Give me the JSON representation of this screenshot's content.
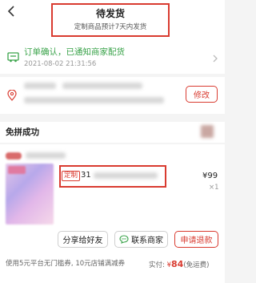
{
  "header": {
    "back_icon": "chevron-left-icon",
    "title": "待发货",
    "subtitle": "定制商品预计7天内发货"
  },
  "logistics": {
    "icon": "truck-icon",
    "status": "订单确认，已通知商家配货",
    "time": "2021-08-02 21:31:56",
    "arrow_icon": "chevron-right-icon",
    "status_color": "#3aa34a"
  },
  "address": {
    "icon": "location-pin-icon",
    "edit_label": "修改"
  },
  "group": {
    "label": "免拼成功"
  },
  "product": {
    "tag": "定制",
    "name_prefix": "31",
    "price": "¥99",
    "quantity": "×1"
  },
  "actions": {
    "share": "分享给好友",
    "contact": "联系商家",
    "contact_icon": "chat-bubble-icon",
    "refund": "申请退款"
  },
  "footer": {
    "coupon_note": "使用5元平台无门槛券, 10元店铺满减券",
    "paid_label": "实付: ",
    "currency": "¥",
    "paid_amount": "84",
    "shipping_note": "(免运费)"
  },
  "colors": {
    "accent": "#d93b30",
    "success": "#3aa34a",
    "background": "#f4f4f4"
  }
}
